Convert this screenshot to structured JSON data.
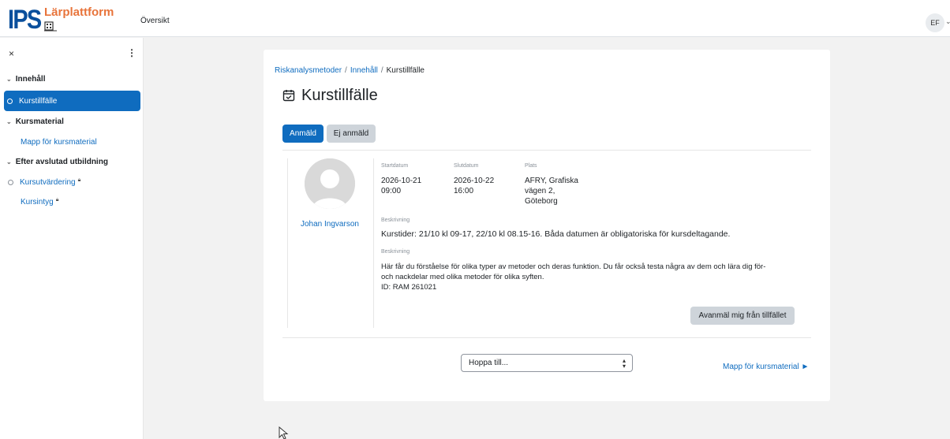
{
  "header": {
    "logo_main": "IPS",
    "logo_text": "Lärplattform",
    "nav_link": "Översikt",
    "user_initials": "EF"
  },
  "sidebar": {
    "close_label": "×",
    "menu_label": "⋮",
    "sections": [
      {
        "label": "Innehåll"
      },
      {
        "label": "Kursmaterial"
      },
      {
        "label": "Efter avslutad utbildning"
      }
    ],
    "items": [
      {
        "label": "Kurstillfälle"
      },
      {
        "label": "Mapp för kursmaterial"
      },
      {
        "label": "Kursutvärdering"
      },
      {
        "label": "Kursintyg"
      }
    ]
  },
  "breadcrumb": {
    "items": [
      "Riskanalysmetoder",
      "Innehåll",
      "Kurstillfälle"
    ],
    "separator": "/"
  },
  "page_title": "Kurstillfälle",
  "tabs": {
    "registered": "Anmäld",
    "not_registered": "Ej anmäld"
  },
  "session": {
    "teacher_name": "Johan Ingvarson",
    "start_label": "Startdatum",
    "start_date": "2026-10-21",
    "start_time": "09:00",
    "end_label": "Slutdatum",
    "end_date": "2026-10-22",
    "end_time": "16:00",
    "place_label": "Plats",
    "place_line1": "AFRY, Grafiska",
    "place_line2": "vägen 2,",
    "place_line3": "Göteborg",
    "desc1_label": "Beskrivning",
    "desc1_text": "Kurstider: 21/10 kl 09-17, 22/10 kl 08.15-16. Båda datumen är obligatoriska för kursdeltagande.",
    "desc2_label": "Beskrivning",
    "desc2_line1": "Här får du förståelse för olika typer av metoder och deras funktion. Du får också testa några av dem och lära dig för-",
    "desc2_line2": "och nackdelar med olika metoder för olika syften.",
    "desc2_line3": "ID: RAM 261021",
    "unregister_label": "Avanmäl mig från tillfället"
  },
  "footer_nav": {
    "jump_placeholder": "Hoppa till...",
    "next_link": "Mapp för kursmaterial ►"
  },
  "colors": {
    "primary": "#0f6cbf",
    "logo_blue": "#0a4f9c",
    "logo_orange": "#e8743b"
  }
}
